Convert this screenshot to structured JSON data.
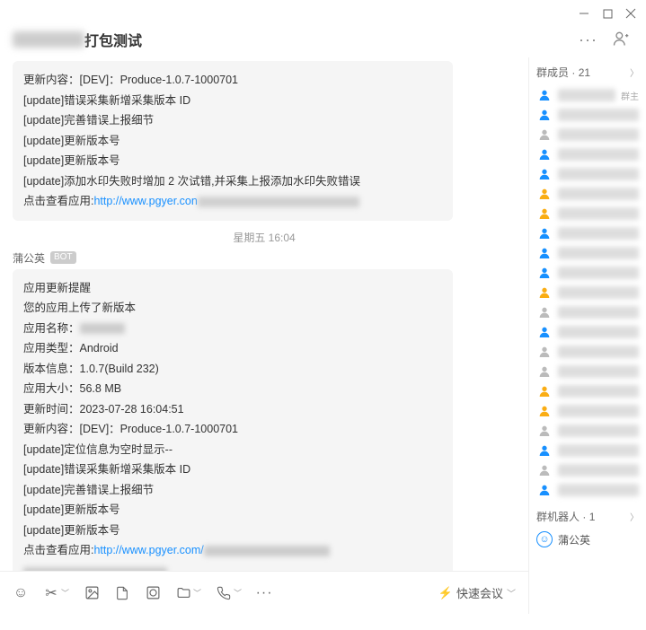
{
  "header": {
    "title_prefix_hidden": "XXXX",
    "title_suffix": "打包测试"
  },
  "chat": {
    "msg1": {
      "lines": [
        "更新内容：[DEV]：Produce-1.0.7-1000701",
        "[update]错误采集新增采集版本 ID",
        "[update]完善错误上报细节",
        "[update]更新版本号",
        "[update]更新版本号",
        "[update]添加水印失败时增加 2 次试错,并采集上报添加水印失败错误"
      ],
      "link_prefix": "点击查看应用:",
      "link_url": "http://www.pgyer.con"
    },
    "time_separator": "星期五 16:04",
    "sender_name": "蒲公英",
    "bot_badge": "BOT",
    "msg2": {
      "title": "应用更新提醒",
      "subtitle": "您的应用上传了新版本",
      "app_name_label": "应用名称：",
      "app_type_label": "应用类型：",
      "app_type_value": "Android",
      "version_label": "版本信息：",
      "version_value": "1.0.7(Build 232)",
      "size_label": "应用大小：",
      "size_value": "56.8 MB",
      "time_label": "更新时间：",
      "time_value": "2023-07-28 16:04:51",
      "content_label": "更新内容：",
      "content_value": "[DEV]：Produce-1.0.7-1000701",
      "updates": [
        "[update]定位信息为空时显示--",
        "[update]错误采集新增采集版本 ID",
        "[update]完善错误上报细节",
        "[update]更新版本号",
        "[update]更新版本号"
      ],
      "link_prefix": "点击查看应用:",
      "link_url": "http://www.pgyer.com/"
    }
  },
  "toolbar": {
    "quick_meeting": "快速会议"
  },
  "sidebar": {
    "members_label": "群成员",
    "members_count": "21",
    "owner_tag": "群主",
    "bots_label": "群机器人",
    "bots_count": "1",
    "bot_name": "蒲公英",
    "members": [
      {
        "color": "blue",
        "owner": true
      },
      {
        "color": "blue"
      },
      {
        "color": "gray"
      },
      {
        "color": "blue"
      },
      {
        "color": "blue"
      },
      {
        "color": "orange"
      },
      {
        "color": "orange"
      },
      {
        "color": "blue"
      },
      {
        "color": "blue"
      },
      {
        "color": "blue"
      },
      {
        "color": "orange"
      },
      {
        "color": "gray"
      },
      {
        "color": "blue"
      },
      {
        "color": "gray"
      },
      {
        "color": "gray"
      },
      {
        "color": "orange"
      },
      {
        "color": "orange"
      },
      {
        "color": "gray"
      },
      {
        "color": "blue"
      },
      {
        "color": "gray"
      },
      {
        "color": "blue"
      }
    ]
  }
}
